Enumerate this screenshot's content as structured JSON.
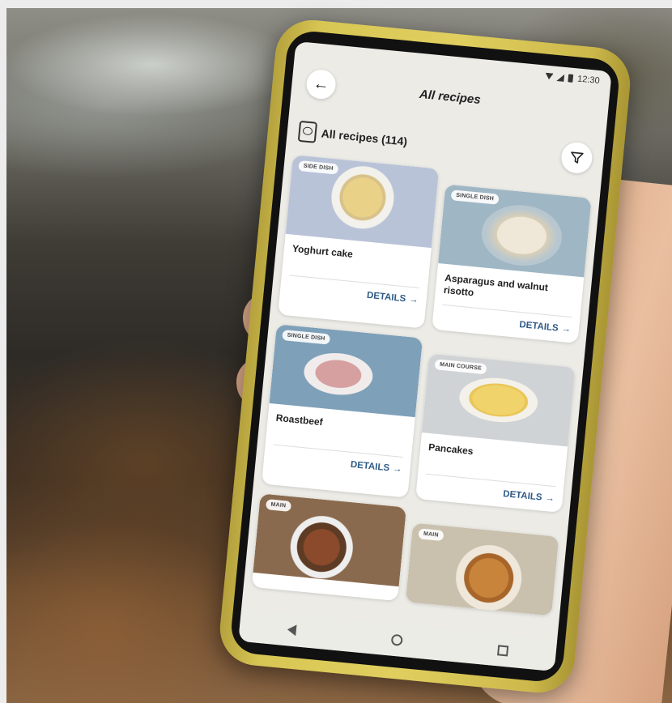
{
  "status_bar": {
    "time": "12:30"
  },
  "header": {
    "title": "All recipes",
    "back_icon": "arrow-left-icon"
  },
  "subheader": {
    "title": "All recipes (114)",
    "book_icon": "recipe-book-icon",
    "filter_icon": "filter-icon"
  },
  "recipes": [
    {
      "category": "SIDE DISH",
      "name": "Yoghurt cake",
      "action": "DETAILS"
    },
    {
      "category": "SINGLE DISH",
      "name": "Asparagus and walnut risotto",
      "action": "DETAILS"
    },
    {
      "category": "SINGLE DISH",
      "name": "Roastbeef",
      "action": "DETAILS"
    },
    {
      "category": "MAIN COURSE",
      "name": "Pancakes",
      "action": "DETAILS"
    },
    {
      "category": "MAIN",
      "name": "",
      "action": ""
    },
    {
      "category": "MAIN",
      "name": "",
      "action": ""
    }
  ],
  "colors": {
    "phone_case": "#d8c654",
    "screen_bg": "#ecebe6",
    "action_text": "#2f5b86"
  }
}
